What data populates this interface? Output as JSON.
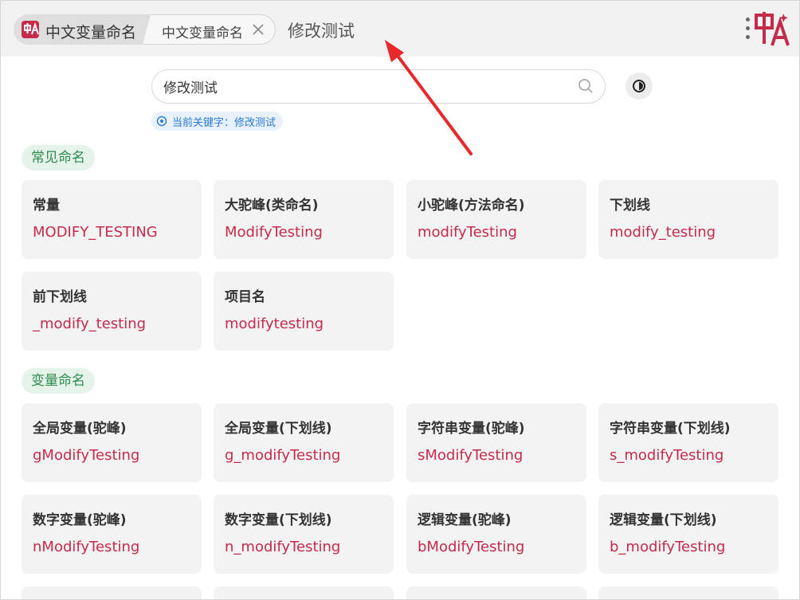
{
  "header": {
    "app_tab_label": "中文变量命名",
    "query_tab_label": "中文变量命名",
    "query_title": "修改测试"
  },
  "search": {
    "value": "修改测试",
    "keyword_text": "当前关键字：修改测试"
  },
  "sections": [
    {
      "title": "常见命名",
      "cards": [
        {
          "title": "常量",
          "value": "MODIFY_TESTING"
        },
        {
          "title": "大驼峰(类命名)",
          "value": "ModifyTesting"
        },
        {
          "title": "小驼峰(方法命名)",
          "value": "modifyTesting"
        },
        {
          "title": "下划线",
          "value": "modify_testing"
        },
        {
          "title": "前下划线",
          "value": "_modify_testing"
        },
        {
          "title": "项目名",
          "value": "modifytesting"
        }
      ]
    },
    {
      "title": "变量命名",
      "cards": [
        {
          "title": "全局变量(驼峰)",
          "value": "gModifyTesting"
        },
        {
          "title": "全局变量(下划线)",
          "value": "g_modifyTesting"
        },
        {
          "title": "字符串变量(驼峰)",
          "value": "sModifyTesting"
        },
        {
          "title": "字符串变量(下划线)",
          "value": "s_modifyTesting"
        },
        {
          "title": "数字变量(驼峰)",
          "value": "nModifyTesting"
        },
        {
          "title": "数字变量(下划线)",
          "value": "n_modifyTesting"
        },
        {
          "title": "逻辑变量(驼峰)",
          "value": "bModifyTesting"
        },
        {
          "title": "逻辑变量(下划线)",
          "value": "b_modifyTesting"
        }
      ]
    }
  ],
  "colors": {
    "accent": "#c42b4a",
    "section_text": "#2e8b4f",
    "keyword_text": "#2a7ad6",
    "arrow": "#e8282b"
  },
  "icons": [
    "app-logo-icon",
    "close-icon",
    "more-icon",
    "search-icon",
    "theme-toggle-icon",
    "target-icon",
    "annotation-arrow"
  ]
}
